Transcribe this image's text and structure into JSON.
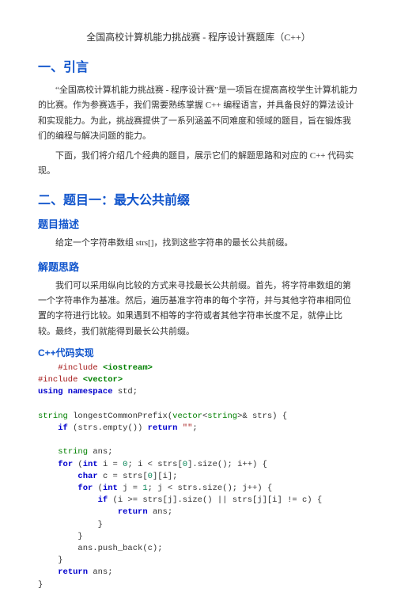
{
  "doc_title": "全国高校计算机能力挑战赛 - 程序设计赛题库（C++）",
  "section1": {
    "heading": "一、引言",
    "p1": "“全国高校计算机能力挑战赛 - 程序设计赛”是一项旨在提高高校学生计算机能力的比赛。作为参赛选手，我们需要熟练掌握 C++ 编程语言，并具备良好的算法设计和实现能力。为此，挑战赛提供了一系列涵盖不同难度和领域的题目，旨在锻炼我们的编程与解决问题的能力。",
    "p2": "下面，我们将介绍几个经典的题目，展示它们的解题思路和对应的 C++ 代码实现。"
  },
  "section2": {
    "heading": "二、题目一：最大公共前缀",
    "sub1": "题目描述",
    "desc": "给定一个字符串数组 strs[]，找到这些字符串的最长公共前缀。",
    "sub2": "解题思路",
    "p_sol": "我们可以采用纵向比较的方式来寻找最长公共前缀。首先，将字符串数组的第一个字符串作为基准。然后，遍历基准字符串的每个字符，并与其他字符串相同位置的字符进行比较。如果遇到不相等的字符或者其他字符串长度不足，就停止比较。最终，我们就能得到最长公共前缀。",
    "sub3": "C++代码实现"
  },
  "code_lines": [
    [
      {
        "t": "    ",
        "c": ""
      },
      {
        "t": "#include",
        "c": "pp"
      },
      {
        "t": " ",
        "c": ""
      },
      {
        "t": "<iostream>",
        "c": "kw-green"
      }
    ],
    [
      {
        "t": "#include",
        "c": "pp"
      },
      {
        "t": " ",
        "c": ""
      },
      {
        "t": "<vector>",
        "c": "kw-green"
      }
    ],
    [
      {
        "t": "using namespace",
        "c": "kw-blue"
      },
      {
        "t": " std;",
        "c": ""
      }
    ],
    [
      {
        "t": "",
        "c": ""
      }
    ],
    [
      {
        "t": "string",
        "c": "type"
      },
      {
        "t": " longestCommonPrefix(",
        "c": ""
      },
      {
        "t": "vector",
        "c": "type"
      },
      {
        "t": "<",
        "c": ""
      },
      {
        "t": "string",
        "c": "type"
      },
      {
        "t": ">& strs) {",
        "c": ""
      }
    ],
    [
      {
        "t": "    ",
        "c": ""
      },
      {
        "t": "if",
        "c": "kw-blue"
      },
      {
        "t": " (strs.empty()) ",
        "c": ""
      },
      {
        "t": "return",
        "c": "kw-blue"
      },
      {
        "t": " ",
        "c": ""
      },
      {
        "t": "\"\"",
        "c": "str"
      },
      {
        "t": ";",
        "c": ""
      }
    ],
    [
      {
        "t": "",
        "c": ""
      }
    ],
    [
      {
        "t": "    ",
        "c": ""
      },
      {
        "t": "string",
        "c": "type"
      },
      {
        "t": " ans;",
        "c": ""
      }
    ],
    [
      {
        "t": "    ",
        "c": ""
      },
      {
        "t": "for",
        "c": "kw-blue"
      },
      {
        "t": " (",
        "c": ""
      },
      {
        "t": "int",
        "c": "kw-blue"
      },
      {
        "t": " i = ",
        "c": ""
      },
      {
        "t": "0",
        "c": "num"
      },
      {
        "t": "; i < strs[",
        "c": ""
      },
      {
        "t": "0",
        "c": "num"
      },
      {
        "t": "].size(); i++) {",
        "c": ""
      }
    ],
    [
      {
        "t": "        ",
        "c": ""
      },
      {
        "t": "char",
        "c": "kw-blue"
      },
      {
        "t": " c = strs[",
        "c": ""
      },
      {
        "t": "0",
        "c": "num"
      },
      {
        "t": "][i];",
        "c": ""
      }
    ],
    [
      {
        "t": "        ",
        "c": ""
      },
      {
        "t": "for",
        "c": "kw-blue"
      },
      {
        "t": " (",
        "c": ""
      },
      {
        "t": "int",
        "c": "kw-blue"
      },
      {
        "t": " j = ",
        "c": ""
      },
      {
        "t": "1",
        "c": "num"
      },
      {
        "t": "; j < strs.size(); j++) {",
        "c": ""
      }
    ],
    [
      {
        "t": "            ",
        "c": ""
      },
      {
        "t": "if",
        "c": "kw-blue"
      },
      {
        "t": " (i >= strs[j].size() || strs[j][i] != c) {",
        "c": ""
      }
    ],
    [
      {
        "t": "                ",
        "c": ""
      },
      {
        "t": "return",
        "c": "kw-blue"
      },
      {
        "t": " ans;",
        "c": ""
      }
    ],
    [
      {
        "t": "            }",
        "c": ""
      }
    ],
    [
      {
        "t": "        }",
        "c": ""
      }
    ],
    [
      {
        "t": "        ans.push_back(c);",
        "c": ""
      }
    ],
    [
      {
        "t": "    }",
        "c": ""
      }
    ],
    [
      {
        "t": "    ",
        "c": ""
      },
      {
        "t": "return",
        "c": "kw-blue"
      },
      {
        "t": " ans;",
        "c": ""
      }
    ],
    [
      {
        "t": "}",
        "c": ""
      }
    ]
  ]
}
